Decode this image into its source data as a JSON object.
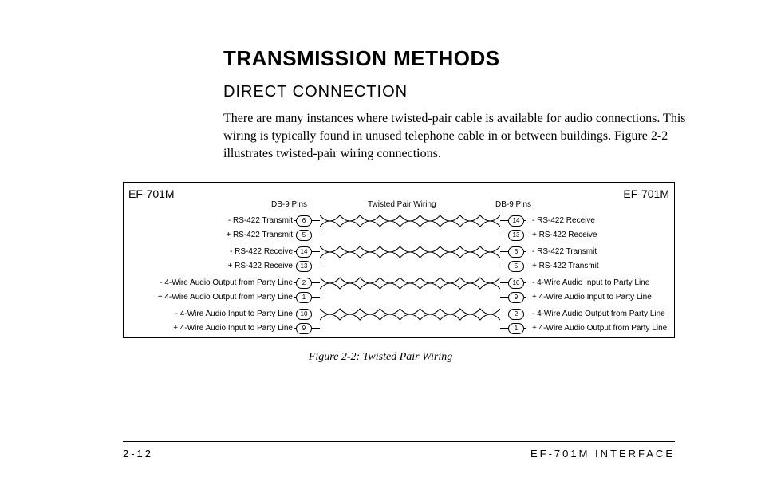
{
  "title": "Transmission Methods",
  "subtitle": "Direct Connection",
  "body": "There are many instances where twisted-pair cable is available for audio connections. This wiring is typically found in unused telephone cable in or between buildings. Figure 2-2 illustrates twisted-pair wiring connections.",
  "diagram": {
    "device_left": "EF-701M",
    "device_right": "EF-701M",
    "db9_left_hdr": "DB-9 Pins",
    "twisted_hdr": "Twisted Pair Wiring",
    "db9_right_hdr": "DB-9 Pins",
    "rows": [
      {
        "left_label": "- RS-422 Transmit",
        "left_pin": "6",
        "right_pin": "14",
        "right_label": "- RS-422 Receive"
      },
      {
        "left_label": "+ RS-422 Transmit",
        "left_pin": "5",
        "right_pin": "13",
        "right_label": "+ RS-422 Receive"
      },
      {
        "left_label": "- RS-422 Receive",
        "left_pin": "14",
        "right_pin": "6",
        "right_label": "- RS-422 Transmit"
      },
      {
        "left_label": "+ RS-422 Receive",
        "left_pin": "13",
        "right_pin": "5",
        "right_label": "+ RS-422 Transmit"
      },
      {
        "left_label": "- 4-Wire Audio Output from Party Line",
        "left_pin": "2",
        "right_pin": "10",
        "right_label": "- 4-Wire Audio Input to Party Line"
      },
      {
        "left_label": "+ 4-Wire Audio Output from Party Line",
        "left_pin": "1",
        "right_pin": "9",
        "right_label": "+ 4-Wire Audio Input to Party Line"
      },
      {
        "left_label": "- 4-Wire Audio Input to Party Line",
        "left_pin": "10",
        "right_pin": "2",
        "right_label": "- 4-Wire Audio Output from Party Line"
      },
      {
        "left_label": "+ 4-Wire Audio Input to Party Line",
        "left_pin": "9",
        "right_pin": "1",
        "right_label": "+ 4-Wire Audio Output from Party Line"
      }
    ]
  },
  "caption": "Figure 2-2: Twisted Pair Wiring",
  "page_number": "2-12",
  "footer_right": "EF-701M INTERFACE"
}
